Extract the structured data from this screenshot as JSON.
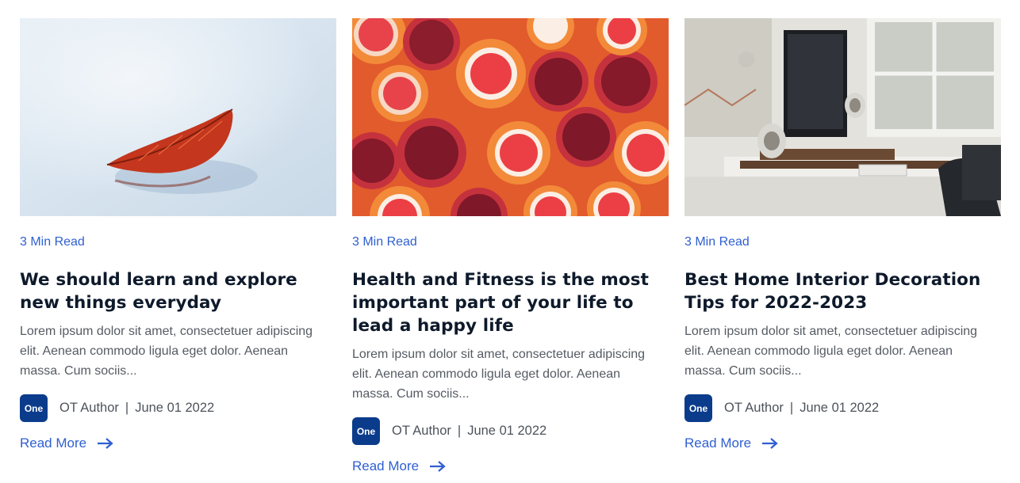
{
  "cards": [
    {
      "image_alt": "red leaf on water",
      "read_time": "3 Min Read",
      "title": "We should learn and explore new things everyday",
      "excerpt": "Lorem ipsum dolor sit amet, consectetuer adipiscing elit. Aenean commodo ligula eget dolor. Aenean massa. Cum sociis...",
      "avatar_text": "One",
      "author": "OT Author",
      "separator": "|",
      "date": "June 01 2022",
      "read_more": "Read More",
      "arrow_icon": "arrow-right-icon"
    },
    {
      "image_alt": "grapefruit and pomegranate halves",
      "read_time": "3 Min Read",
      "title": "Health and Fitness is the most important part of your life to lead a happy life",
      "excerpt": "Lorem ipsum dolor sit amet, consectetuer adipiscing elit. Aenean commodo ligula eget dolor. Aenean massa. Cum sociis...",
      "avatar_text": "One",
      "author": "OT Author",
      "separator": "|",
      "date": "June 01 2022",
      "read_more": "Read More",
      "arrow_icon": "arrow-right-icon"
    },
    {
      "image_alt": "home office desk with computer",
      "read_time": "3 Min Read",
      "title": "Best Home Interior Decoration Tips for 2022-2023",
      "excerpt": "Lorem ipsum dolor sit amet, consectetuer adipiscing elit. Aenean commodo ligula eget dolor. Aenean massa. Cum sociis...",
      "avatar_text": "One",
      "author": "OT Author",
      "separator": "|",
      "date": "June 01 2022",
      "read_more": "Read More",
      "arrow_icon": "arrow-right-icon"
    }
  ],
  "colors": {
    "accent": "#2f5fd0",
    "avatar_bg": "#0b3c8c",
    "title": "#0e1a2b",
    "body_text": "#555b63"
  }
}
